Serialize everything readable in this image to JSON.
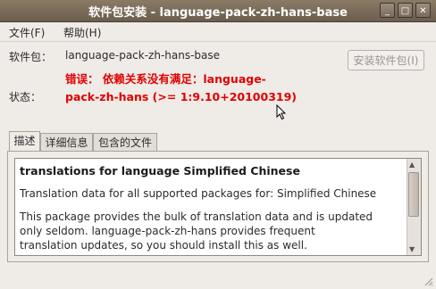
{
  "window": {
    "title": "软件包安装 - language-pack-zh-hans-base",
    "minimize_glyph": "_",
    "maximize_glyph": "□",
    "close_glyph": "✕"
  },
  "menu": {
    "file": "文件(F)",
    "help": "帮助(H)"
  },
  "package": {
    "label": "软件包：",
    "name": "language-pack-zh-hans-base",
    "status_label": "状态：",
    "status_line1": "错误： 依赖关系没有满足：language-",
    "status_line2": "pack-zh-hans (>= 1:9.10+20100319)",
    "install_button": "安装软件包(I)"
  },
  "tabs": [
    {
      "label": "描述"
    },
    {
      "label": "详细信息"
    },
    {
      "label": "包含的文件"
    }
  ],
  "description": {
    "title": "translations for language Simplified Chinese",
    "line1": "Translation data for all supported packages for: Simplified Chinese",
    "line2": "This package provides the bulk of translation data and is updated",
    "line3": "only seldom. language-pack-zh-hans provides frequent",
    "line4": "translation updates, so you should install this as well."
  },
  "colors": {
    "error": "#e00000",
    "titlebar": "#7a6c5c"
  }
}
